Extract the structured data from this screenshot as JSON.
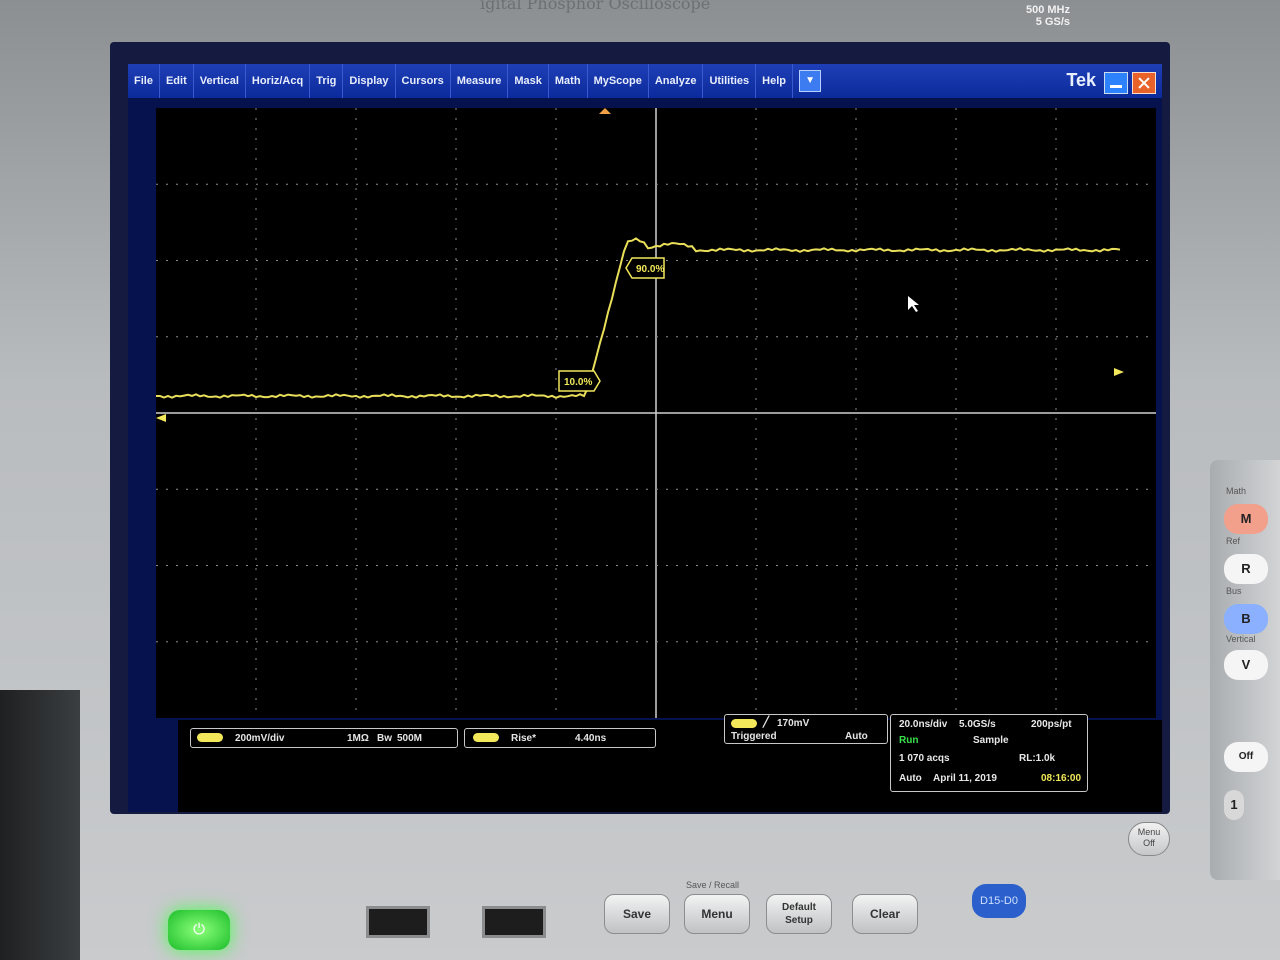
{
  "bezel": {
    "title": "igital Phosphor Oscilloscope",
    "spec": [
      "500 MHz",
      "5 GS/s"
    ]
  },
  "menubar": {
    "items": [
      "File",
      "Edit",
      "Vertical",
      "Horiz/Acq",
      "Trig",
      "Display",
      "Cursors",
      "Measure",
      "Mask",
      "Math",
      "MyScope",
      "Analyze",
      "Utilities",
      "Help"
    ],
    "dropdown_icon": "chevron-down-icon",
    "brand": "Tek"
  },
  "waveform": {
    "markers": {
      "low": "10.0%",
      "high": "90.0%"
    },
    "color": "#e9df5a"
  },
  "channel": {
    "scale": "200mV/div",
    "coupling": "1MΩ",
    "bandwidth": "500M"
  },
  "measurement": {
    "label": "Rise*",
    "value": "4.40ns"
  },
  "trigger": {
    "level": "170mV",
    "state": "Triggered",
    "mode": "Auto"
  },
  "timebase": {
    "scale": "20.0ns/div",
    "rate": "5.0GS/s",
    "points": "200ps/pt",
    "status": "Run",
    "mode": "Sample",
    "acqs": "1 070 acqs",
    "record": "RL:1.0k",
    "date_mode": "Auto",
    "date": "April 11, 2019",
    "time": "08:16:00"
  },
  "front_panel": {
    "buttons": [
      {
        "key": "math",
        "label": "M",
        "caption": "Math",
        "color": "#f2a08c"
      },
      {
        "key": "ref",
        "label": "R",
        "caption": "Ref",
        "color": "#f5f5f5"
      },
      {
        "key": "bus",
        "label": "B",
        "caption": "Bus",
        "color": "#8ab0ff"
      },
      {
        "key": "vertical",
        "label": "V",
        "caption": "Vertical",
        "color": "#f5f5f5"
      },
      {
        "key": "off",
        "label": "Off",
        "caption": "",
        "color": "#f5f5f5"
      }
    ],
    "channel_number": "1",
    "menu_off": [
      "Menu",
      "Off"
    ],
    "digital": "D15-D0"
  },
  "bottom": {
    "group_label": "Save / Recall",
    "buttons": [
      "Save",
      "Menu",
      "Default Setup",
      "Clear"
    ]
  }
}
